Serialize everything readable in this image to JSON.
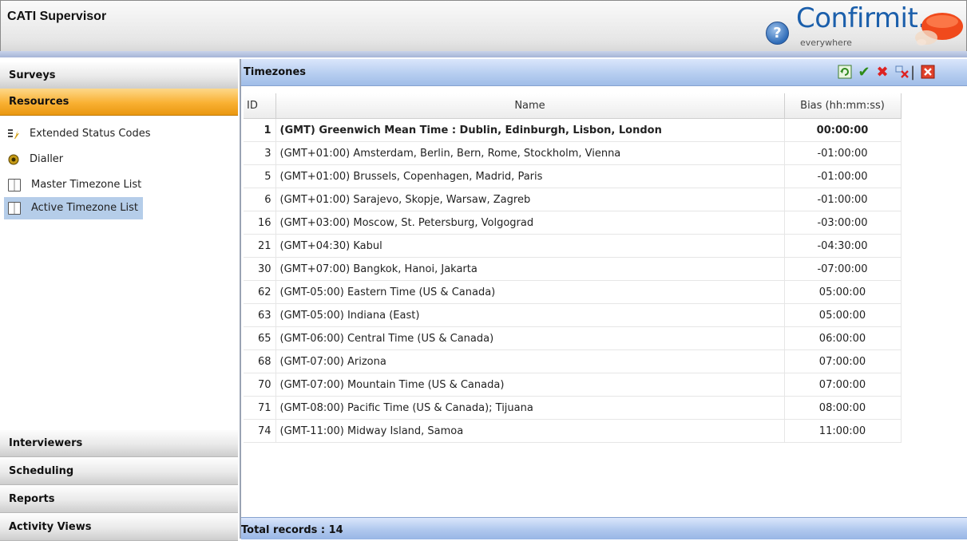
{
  "header": {
    "title": "CATI Supervisor",
    "brand_name": "Confirmit.",
    "brand_tagline": "everywhere",
    "help_icon": "question-circle-icon",
    "brand_color": "#1b5fab"
  },
  "sidebar": {
    "sections": {
      "surveys": "Surveys",
      "resources": "Resources",
      "interviewers": "Interviewers",
      "scheduling": "Scheduling",
      "reports": "Reports",
      "activity_views": "Activity Views"
    },
    "resources_items": [
      {
        "label": "Extended Status Codes",
        "icon": "status-codes-icon"
      },
      {
        "label": "Dialler",
        "icon": "dialler-icon"
      },
      {
        "label": "Master Timezone List",
        "icon": "book-icon"
      },
      {
        "label": "Active Timezone List",
        "icon": "book-icon",
        "selected": true
      }
    ],
    "active_color": "#f9b032"
  },
  "panel": {
    "title": "Timezones",
    "toolbar": [
      "refresh-icon",
      "checkmark-icon",
      "delete-x-icon",
      "filter-icon",
      "close-icon"
    ],
    "footer": "Total records : 14"
  },
  "table": {
    "columns": [
      "ID",
      "Name",
      "Bias (hh:mm:ss)"
    ],
    "rows": [
      {
        "id": "1",
        "name": "(GMT) Greenwich Mean Time : Dublin, Edinburgh, Lisbon, London",
        "bias": "00:00:00",
        "bold": true
      },
      {
        "id": "3",
        "name": "(GMT+01:00) Amsterdam, Berlin, Bern, Rome, Stockholm, Vienna",
        "bias": "-01:00:00"
      },
      {
        "id": "5",
        "name": "(GMT+01:00) Brussels, Copenhagen, Madrid, Paris",
        "bias": "-01:00:00"
      },
      {
        "id": "6",
        "name": "(GMT+01:00) Sarajevo, Skopje, Warsaw, Zagreb",
        "bias": "-01:00:00"
      },
      {
        "id": "16",
        "name": "(GMT+03:00) Moscow, St. Petersburg, Volgograd",
        "bias": "-03:00:00"
      },
      {
        "id": "21",
        "name": "(GMT+04:30) Kabul",
        "bias": "-04:30:00"
      },
      {
        "id": "30",
        "name": "(GMT+07:00) Bangkok, Hanoi, Jakarta",
        "bias": "-07:00:00"
      },
      {
        "id": "62",
        "name": "(GMT-05:00) Eastern Time (US & Canada)",
        "bias": "05:00:00"
      },
      {
        "id": "63",
        "name": "(GMT-05:00) Indiana (East)",
        "bias": "05:00:00"
      },
      {
        "id": "65",
        "name": "(GMT-06:00) Central Time (US & Canada)",
        "bias": "06:00:00"
      },
      {
        "id": "68",
        "name": "(GMT-07:00) Arizona",
        "bias": "07:00:00"
      },
      {
        "id": "70",
        "name": "(GMT-07:00) Mountain Time (US & Canada)",
        "bias": "07:00:00"
      },
      {
        "id": "71",
        "name": "(GMT-08:00) Pacific Time (US & Canada); Tijuana",
        "bias": "08:00:00"
      },
      {
        "id": "74",
        "name": "(GMT-11:00) Midway Island, Samoa",
        "bias": "11:00:00"
      }
    ]
  }
}
